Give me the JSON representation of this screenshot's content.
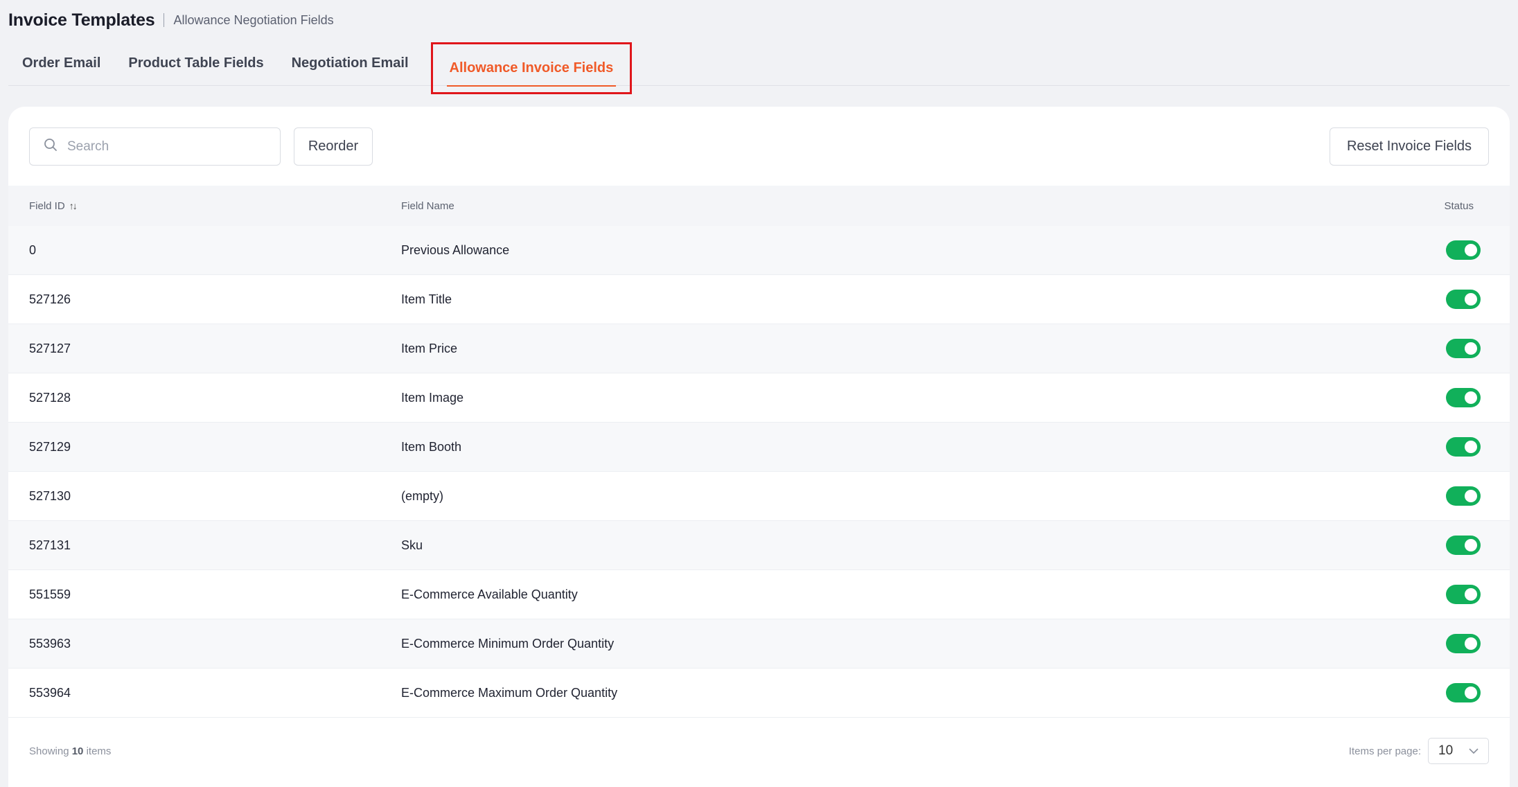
{
  "header": {
    "title": "Invoice Templates",
    "subtitle": "Allowance Negotiation Fields"
  },
  "tabs": [
    {
      "label": "Order Email"
    },
    {
      "label": "Product Table Fields"
    },
    {
      "label": "Negotiation Email"
    },
    {
      "label": "Allowance Invoice Fields",
      "active": true
    }
  ],
  "toolbar": {
    "search_placeholder": "Search",
    "reorder_label": "Reorder",
    "reset_label": "Reset Invoice Fields"
  },
  "table": {
    "columns": {
      "field_id": "Field ID",
      "field_name": "Field Name",
      "status": "Status",
      "sort_icon": "↑↓"
    },
    "rows": [
      {
        "id": "0",
        "name": "Previous Allowance",
        "enabled": true
      },
      {
        "id": "527126",
        "name": "Item Title",
        "enabled": true
      },
      {
        "id": "527127",
        "name": "Item Price",
        "enabled": true
      },
      {
        "id": "527128",
        "name": "Item Image",
        "enabled": true
      },
      {
        "id": "527129",
        "name": "Item Booth",
        "enabled": true
      },
      {
        "id": "527130",
        "name": "(empty)",
        "enabled": true
      },
      {
        "id": "527131",
        "name": "Sku",
        "enabled": true
      },
      {
        "id": "551559",
        "name": "E-Commerce Available Quantity",
        "enabled": true
      },
      {
        "id": "553963",
        "name": "E-Commerce Minimum Order Quantity",
        "enabled": true
      },
      {
        "id": "553964",
        "name": "E-Commerce Maximum Order Quantity",
        "enabled": true
      }
    ]
  },
  "footer": {
    "showing_prefix": "Showing",
    "showing_count": "10",
    "showing_suffix": "items",
    "per_page_label": "Items per page:",
    "per_page_value": "10"
  },
  "colors": {
    "accent": "#f05a28",
    "toggle_on": "#11b05a",
    "highlight_box": "#e0161b"
  }
}
